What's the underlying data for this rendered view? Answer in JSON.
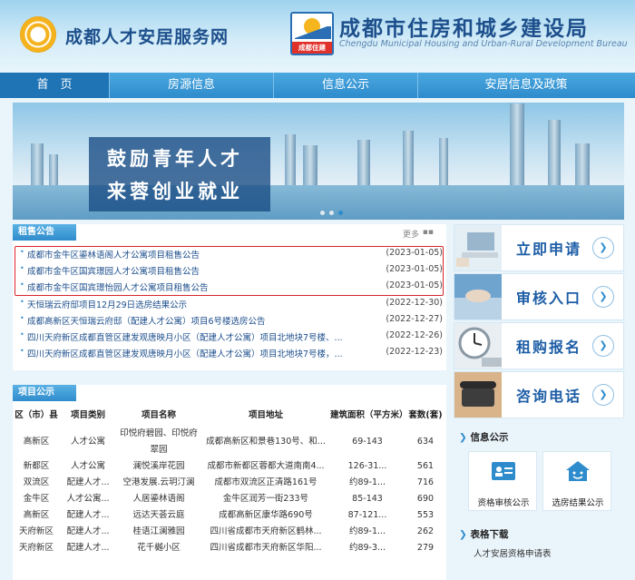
{
  "header": {
    "site_left": "成都人才安居服务网",
    "site_right": "成都市住房和城乡建设局",
    "site_right_en": "Chengdu Municipal Housing and Urban-Rural Development Bureau",
    "logo_badge": "成都住建"
  },
  "nav": [
    "首　页",
    "房源信息",
    "信息公示",
    "安居信息及政策"
  ],
  "banner": {
    "line1": "鼓励青年人才",
    "line2": "来蓉创业就业"
  },
  "notice": {
    "title": "租售公告",
    "more": "更多",
    "items": [
      {
        "title": "成都市金牛区鎏林语阁人才公寓项目租售公告",
        "date": "(2023-01-05)"
      },
      {
        "title": "成都市金牛区国宾璟园人才公寓项目租售公告",
        "date": "(2023-01-05)"
      },
      {
        "title": "成都市金牛区国宾璟怡园人才公寓项目租售公告",
        "date": "(2023-01-05)"
      },
      {
        "title": "天恒瑞云府邸项目12月29日选房结果公示",
        "date": "(2022-12-30)"
      },
      {
        "title": "成都高新区天恒瑞云府邸（配建人才公寓）项目6号楼选房公告",
        "date": "(2022-12-27)"
      },
      {
        "title": "四川天府新区成都直管区建发观唐映月小区（配建人才公寓）项目北地块7号楼、...",
        "date": "(2022-12-26)"
      },
      {
        "title": "四川天府新区成都直管区建发观唐映月小区（配建人才公寓）项目北地块7号楼，...",
        "date": "(2022-12-23)"
      }
    ]
  },
  "projects": {
    "title": "项目公示",
    "headers": [
      "区（市）县",
      "项目类别",
      "项目名称",
      "项目地址",
      "建筑面积（平方米）",
      "套数(套)"
    ],
    "rows": [
      [
        "高新区",
        "人才公寓",
        "印悦府碧园、印悦府翠园",
        "成都高新区和景巷130号、和...",
        "69-143",
        "634"
      ],
      [
        "新都区",
        "人才公寓",
        "澜悦溪岸花园",
        "成都市新都区蓉都大道南南4...",
        "126-31...",
        "561"
      ],
      [
        "双流区",
        "配建人才...",
        "空港发展.云玥汀澜",
        "成都市双流区正清路161号",
        "约89-1...",
        "716"
      ],
      [
        "金牛区",
        "人才公寓...",
        "人居鎏林语阁",
        "金牛区润芳一街233号",
        "85-143",
        "690"
      ],
      [
        "高新区",
        "配建人才...",
        "远达天荟云庭",
        "成都高新区康华路690号",
        "87-121...",
        "553"
      ],
      [
        "天府新区",
        "配建人才...",
        "桂语江澜雅园",
        "四川省成都市天府新区鹤林...",
        "约89-1...",
        "262"
      ],
      [
        "天府新区",
        "配建人才...",
        "花千樾小区",
        "四川省成都市天府新区华阳...",
        "约89-3...",
        "279"
      ]
    ]
  },
  "actions": [
    "立即申请",
    "审核入口",
    "租购报名",
    "咨询电话"
  ],
  "info": {
    "title": "信息公示",
    "cards": [
      "资格审核公示",
      "选房结果公示"
    ]
  },
  "downloads": {
    "title": "表格下载",
    "items": [
      "人才安居资格申请表"
    ]
  },
  "colors": {
    "brand": "#2f8ccc",
    "nav_active": "#1f74b6",
    "highlight": "#d8262b"
  }
}
